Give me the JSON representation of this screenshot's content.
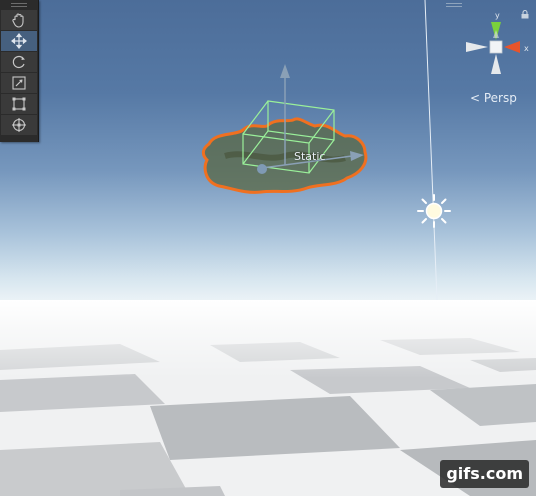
{
  "scene": {
    "camera_mode_label": "< Persp",
    "selected_object_label": "Static",
    "gizmo_axis_x_label": "x",
    "gizmo_axis_y_label": "y"
  },
  "toolbar": {
    "tools": [
      {
        "name": "hand-tool",
        "icon": "hand-icon",
        "active": false
      },
      {
        "name": "move-tool",
        "icon": "move-arrows-icon",
        "active": true
      },
      {
        "name": "rotate-tool",
        "icon": "rotate-icon",
        "active": false
      },
      {
        "name": "scale-tool",
        "icon": "scale-icon",
        "active": false
      },
      {
        "name": "rect-tool",
        "icon": "rect-transform-icon",
        "active": false
      },
      {
        "name": "transform-tool",
        "icon": "transform-icon",
        "active": false
      }
    ]
  },
  "colors": {
    "selection_outline": "#f07020",
    "bounds_box": "#9af09a",
    "gizmo_x": "#e8542a",
    "gizmo_y": "#7ad03c",
    "sky_top": "#4c6d99"
  },
  "watermark": {
    "text": "gifs.com"
  }
}
